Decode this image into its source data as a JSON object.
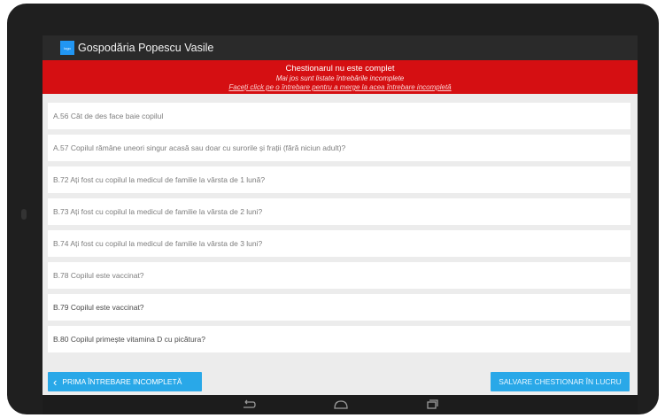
{
  "header": {
    "logo_text": "logo",
    "title": "Gospodăria Popescu Vasile"
  },
  "banner": {
    "title": "Chestionarul nu este complet",
    "subtitle": "Mai jos sunt listate întrebările incomplete",
    "hint": "Faceți click pe o întrebare pentru a merge la acea întrebare incompletă"
  },
  "questions": [
    {
      "label": "A.56 Cât de des face baie copilul"
    },
    {
      "label": "A.57 Copilul rămâne uneori singur acasă sau doar cu surorile și frații (fără niciun adult)?"
    },
    {
      "label": "B.72 Ați fost cu copilul la medicul de familie la vârsta de 1 lună?"
    },
    {
      "label": "B.73 Ați fost cu copilul la medicul de familie la vârsta de 2 luni?"
    },
    {
      "label": "B.74 Ați fost cu copilul la medicul de familie la vârsta de 3 luni?"
    },
    {
      "label": "B.78 Copilul este vaccinat?"
    },
    {
      "label": "B.79 Copilul este vaccinat?"
    },
    {
      "label": "B.80 Copilul primește vitamina D cu picătura?"
    }
  ],
  "buttons": {
    "first_incomplete": "PRIMA ÎNTREBARE INCOMPLETĂ",
    "save": "SALVARE CHESTIONAR ÎN LUCRU"
  },
  "colors": {
    "banner": "#d50f12",
    "button": "#29a8e8",
    "appbar": "#2a2a2a"
  },
  "icons": {
    "back": "chevron-left-icon",
    "nav_back": "back-arrow-icon",
    "nav_home": "home-icon",
    "nav_recent": "recent-apps-icon"
  }
}
